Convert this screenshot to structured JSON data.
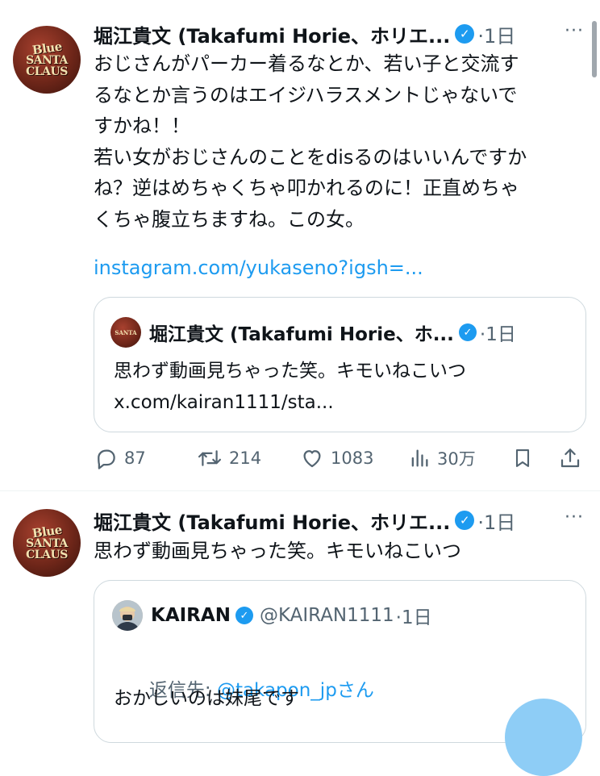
{
  "tweet1": {
    "author_name": "堀江貴文 (Takafumi Horie、ホリエ...",
    "time": "·1日",
    "more": "···",
    "avatar_lines": [
      "Blue",
      "SANTA",
      "CLAUS"
    ],
    "body": "おじさんがパーカー着るなとか、若い子と交流す\nるなとか言うのはエイジハラスメントじゃないで\nすかね！！\n若い女がおじさんのことをdisるのはいいんですか\nね？逆はめちゃくちゃ叩かれるのに！正直めちゃ\nくちゃ腹立ちますね。この女。",
    "link": "instagram.com/yukaseno?igsh=...",
    "quote": {
      "author_name": "堀江貴文 (Takafumi Horie、ホ...",
      "time": "·1日",
      "line1": "思わず動画見ちゃった笑。キモいねこいつ",
      "line2": "x.com/kairan1111/sta..."
    },
    "actions": {
      "replies": "87",
      "retweets": "214",
      "likes": "1083",
      "views": "30万"
    }
  },
  "tweet2": {
    "author_name": "堀江貴文 (Takafumi Horie、ホリエ...",
    "time": "·1日",
    "more": "···",
    "body": "思わず動画見ちゃった笑。キモいねこいつ",
    "quote": {
      "author_name": "KAIRAN",
      "handle": "@KAIRAN1111",
      "time": "·1日",
      "reply_prefix": "返信先: ",
      "reply_handle": "@takapon_jp",
      "reply_suffix": "さん",
      "body": "おかしいのは妹尾です"
    }
  },
  "colors": {
    "accent": "#1d9bf0",
    "text": "#0f1419",
    "secondary": "#536471",
    "border": "#cfd9de"
  },
  "icons": [
    "reply-icon",
    "retweet-icon",
    "like-icon",
    "views-icon",
    "bookmark-icon",
    "share-icon",
    "verified-badge-icon"
  ]
}
